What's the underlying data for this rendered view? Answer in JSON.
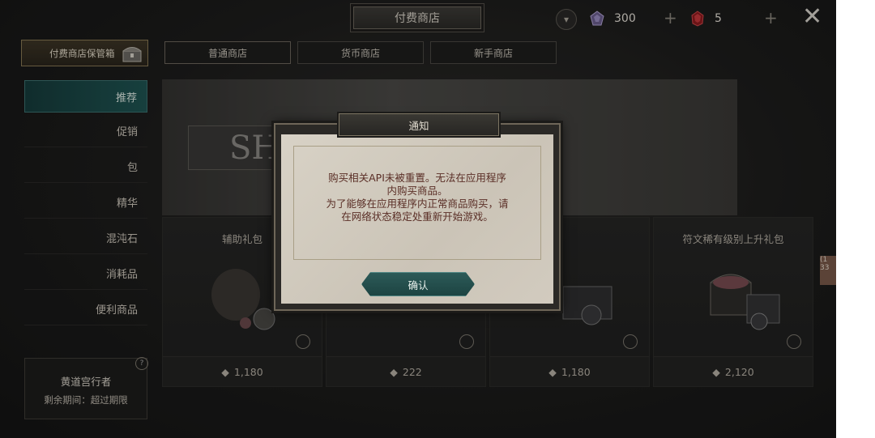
{
  "header": {
    "title": "付费商店",
    "currency1": {
      "icon": "purple-gem-icon",
      "amount": "300"
    },
    "currency2": {
      "icon": "red-gem-icon",
      "amount": "5"
    },
    "plus_symbol": "+",
    "close_symbol": "✕"
  },
  "vault_button": {
    "label": "付费商店保管箱",
    "icon": "chest-icon"
  },
  "tabs": [
    {
      "label": "普通商店"
    },
    {
      "label": "货币商店"
    },
    {
      "label": "新手商店"
    }
  ],
  "sidebar": {
    "items": [
      {
        "label": "推荐"
      },
      {
        "label": "促销"
      },
      {
        "label": "包"
      },
      {
        "label": "精华"
      },
      {
        "label": "混沌石"
      },
      {
        "label": "消耗品"
      },
      {
        "label": "便利商品"
      }
    ],
    "active_index": 0
  },
  "profile": {
    "name": "黄道宫行者",
    "expiry": "剩余期间：超过期限",
    "help_icon": "?"
  },
  "banner": {
    "text": "SH"
  },
  "products": [
    {
      "name": "辅助礼包",
      "price": "1,180"
    },
    {
      "name": "",
      "price": "222"
    },
    {
      "name": "",
      "price": "1,180"
    },
    {
      "name": "符文稀有级别上升礼包",
      "price": "2,120"
    }
  ],
  "edge_tab": {
    "text": "(1\n33"
  },
  "dialog": {
    "title": "通知",
    "message_line1": "购买相关API未被重置。无法在应用程序",
    "message_line2": "内购买商品。",
    "message_line3": "为了能够在应用程序内正常商品购买，请",
    "message_line4": "在网络状态稳定处重新开始游戏。",
    "confirm_label": "确认"
  },
  "colors": {
    "accent_teal": "#1f5553",
    "dialog_text": "#5a2e26",
    "paper": "#d2cbbf"
  }
}
